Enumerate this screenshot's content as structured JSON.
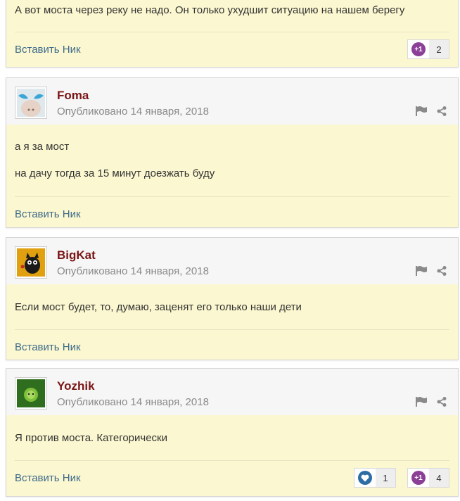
{
  "posts": [
    {
      "text": [
        "А вот моста через реку не надо. Он только ухудшит ситуацию на нашем берегу"
      ],
      "quote_label": "Вставить Ник",
      "reactions": [
        {
          "icon": "plus-one-icon",
          "count": "2"
        }
      ]
    },
    {
      "author": "Foma",
      "date": "Опубликовано 14 января, 2018",
      "text": [
        "а я за мост",
        "на дачу тогда за 15 минут доезжать буду"
      ],
      "quote_label": "Вставить Ник"
    },
    {
      "author": "BigKat",
      "date": "Опубликовано 14 января, 2018",
      "text": [
        "Если мост будет,  то, думаю, заценят его только наши дети"
      ],
      "quote_label": "Вставить Ник"
    },
    {
      "author": "Yozhik",
      "date": "Опубликовано 14 января, 2018",
      "text": [
        "Я против моста. Категорически"
      ],
      "quote_label": "Вставить Ник",
      "reactions": [
        {
          "icon": "heart-icon",
          "count": "1"
        },
        {
          "icon": "plus-one-icon",
          "count": "4"
        }
      ]
    }
  ],
  "reaction_plus_label": "+1",
  "colors": {
    "author": "#7a1515",
    "link": "#3e6b8a",
    "body_bg": "#fbf7d0",
    "plus_one": "#8b3f96",
    "heart": "#2e6da4"
  }
}
